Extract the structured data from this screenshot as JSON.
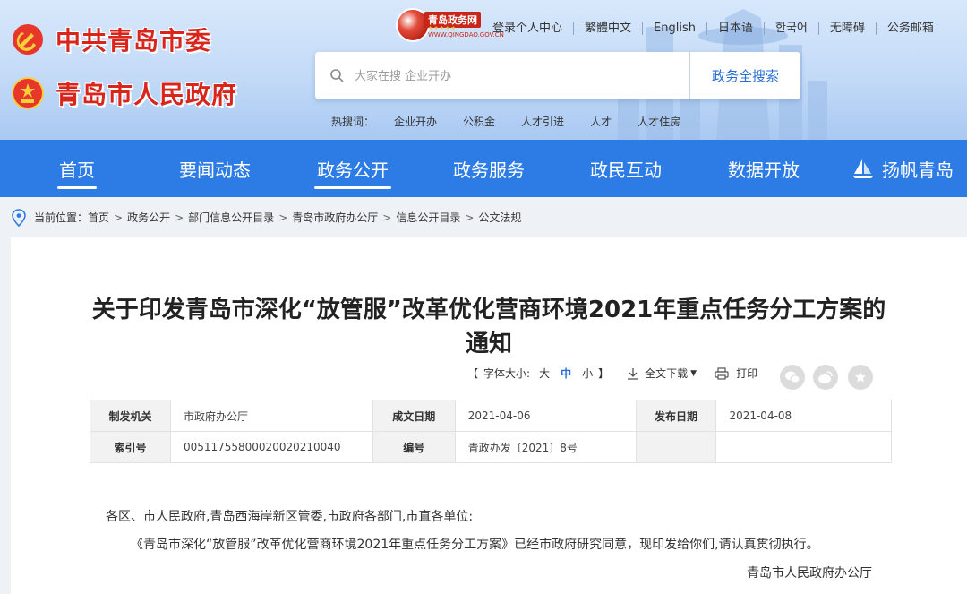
{
  "header": {
    "brand_party": "中共青岛市委",
    "brand_gov": "青岛市人民政府",
    "portal_name": "青岛政务网",
    "portal_domain": "WWW.QINGDAO.GOV.CN",
    "portal_stars": "★★★★★",
    "top_links": [
      "登录个人中心",
      "繁體中文",
      "English",
      "日本语",
      "한국어",
      "无障碍",
      "公务邮箱"
    ],
    "search": {
      "placeholder": "大家在搜 企业开办",
      "button": "政务全搜索"
    },
    "hot_label": "热搜词：",
    "hot_words": [
      "企业开办",
      "公积金",
      "人才引进",
      "人才",
      "人才住房"
    ]
  },
  "nav": {
    "items": [
      "首页",
      "要闻动态",
      "政务公开",
      "政务服务",
      "政民互动",
      "数据开放",
      "扬帆青岛"
    ],
    "active": [
      "首页",
      "政务公开"
    ]
  },
  "breadcrumb": {
    "label": "当前位置：",
    "items": [
      "首页",
      "政务公开",
      "部门信息公开目录",
      "青岛市政府办公厅",
      "信息公开目录",
      "公文法规"
    ],
    "separator": ">"
  },
  "document": {
    "title": "关于印发青岛市深化“放管服”改革优化营商环境2021年重点任务分工方案的通知",
    "tools": {
      "bracket_open": "【",
      "bracket_close": "】",
      "font_size_label": "字体大小:",
      "font_sizes": [
        "大",
        "中",
        "小"
      ],
      "current_size": "中",
      "download": "全文下载",
      "print": "打印"
    },
    "meta": {
      "issuer_label": "制发机关",
      "issuer": "市政府办公厅",
      "date_label": "成文日期",
      "date": "2021-04-06",
      "publish_label": "发布日期",
      "publish": "2021-04-08",
      "index_label": "索引号",
      "index": "00511755800020020210040",
      "number_label": "编号",
      "number": "青政办发〔2021〕8号"
    },
    "salutation": "各区、市人民政府,青岛西海岸新区管委,市政府各部门,市直各单位:",
    "paragraph": "《青岛市深化“放管服”改革优化营商环境2021年重点任务分工方案》已经市政府研究同意，现印发给你们,请认真贯彻执行。",
    "signature": "青岛市人民政府办公厅"
  },
  "colors": {
    "nav_blue": "#2d7be5",
    "brand_red": "#d8261c",
    "link_blue": "#2a6fd6"
  },
  "icons": [
    "party-emblem-icon",
    "national-emblem-icon",
    "search-icon",
    "sail-icon",
    "location-pin-icon",
    "download-icon",
    "print-icon",
    "wechat-icon",
    "weibo-icon",
    "favorite-star-icon"
  ]
}
